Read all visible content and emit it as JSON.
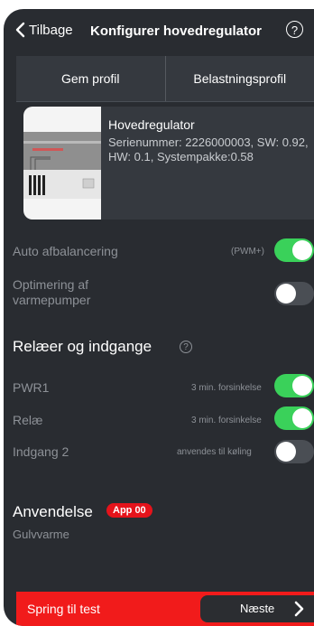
{
  "header": {
    "back_label": "Tilbage",
    "title": "Konfigurer hovedregulator",
    "help_icon": "?"
  },
  "tabs": [
    {
      "label": "Gem profil"
    },
    {
      "label": "Belastningsprofil"
    }
  ],
  "device": {
    "name": "Hovedregulator",
    "info": "Serienummer: 2226000003, SW: 0.92, HW: 0.1, Systempakke:0.58"
  },
  "settings": {
    "auto_balance": {
      "label": "Auto afbalancering",
      "note": "(PWM+)",
      "on": true
    },
    "heatpump": {
      "label": "Optimering af varmepumper",
      "on": false
    }
  },
  "relays": {
    "title": "Relæer og indgange",
    "help_icon": "?",
    "items": [
      {
        "label": "PWR1",
        "note": "3 min. forsinkelse",
        "on": true
      },
      {
        "label": "Relæ",
        "note": "3 min. forsinkelse",
        "on": true
      },
      {
        "label": "Indgang 2",
        "note": "anvendes til køling",
        "on": false
      }
    ]
  },
  "application": {
    "title": "Anvendelse",
    "badge": "App 00",
    "value": "Gulvvarme"
  },
  "bottom": {
    "label": "Spring til test",
    "next_label": "Næste"
  },
  "colors": {
    "background": "#292c31",
    "toggle_on": "#3ad15a",
    "accent_red": "#f11b1b",
    "badge_red": "#e5131b"
  }
}
